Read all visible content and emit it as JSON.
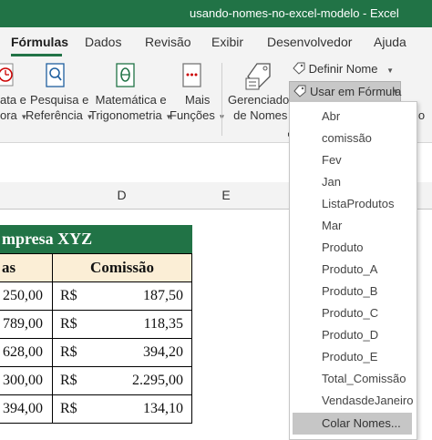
{
  "window": {
    "title": "usando-nomes-no-excel-modelo  -  Excel"
  },
  "tabs": [
    "Fórmulas",
    "Dados",
    "Revisão",
    "Exibir",
    "Desenvolvedor",
    "Ajuda"
  ],
  "ribbon": {
    "data_hora": {
      "line1": "ata e",
      "line2": "ora"
    },
    "pesquisa": {
      "line1": "Pesquisa e",
      "line2": "Referência"
    },
    "matematica": {
      "line1": "Matemática e",
      "line2": "Trigonometria"
    },
    "mais": {
      "line1": "Mais",
      "line2": "Funções"
    },
    "gerenciador": {
      "line1": "Gerenciador",
      "line2": "de Nomes"
    },
    "definir_nome": "Definir Nome",
    "usar_em_formula": "Usar em Fórmula",
    "cut_text": "io"
  },
  "columns": [
    "D",
    "E"
  ],
  "table": {
    "header": "mpresa XYZ",
    "col1_header": "as",
    "col2_header": "Comissão",
    "currency": "R$",
    "rows": [
      {
        "left": "250,00",
        "value": "187,50"
      },
      {
        "left": "789,00",
        "value": "118,35"
      },
      {
        "left": "628,00",
        "value": "394,20"
      },
      {
        "left": "300,00",
        "value": "2.295,00"
      },
      {
        "left": "394,00",
        "value": "134,10"
      }
    ]
  },
  "dropdown": {
    "items": [
      "Abr",
      "comissão",
      "Fev",
      "Jan",
      "ListaProdutos",
      "Mar",
      "Produto",
      "Produto_A",
      "Produto_B",
      "Produto_C",
      "Produto_D",
      "Produto_E",
      "Total_Comissão",
      "VendasdeJaneiro"
    ],
    "footer": "Colar Nomes..."
  }
}
